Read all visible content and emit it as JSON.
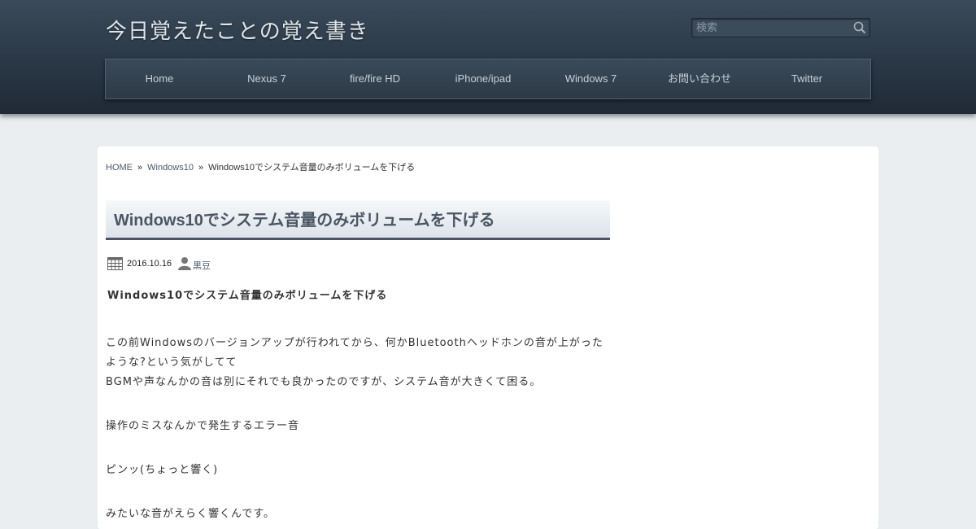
{
  "site": {
    "title": "今日覚えたことの覚え書き"
  },
  "search": {
    "placeholder": "検索",
    "icon": "search-icon"
  },
  "nav": {
    "items": [
      {
        "label": "Home"
      },
      {
        "label": "Nexus 7"
      },
      {
        "label": "fire/fire HD"
      },
      {
        "label": "iPhone/ipad"
      },
      {
        "label": "Windows 7"
      },
      {
        "label": "お問い合わせ"
      },
      {
        "label": "Twitter"
      }
    ]
  },
  "breadcrumb": {
    "home": "HOME",
    "category": "Windows10",
    "current": "Windows10でシステム音量のみボリュームを下げる",
    "separator": "»"
  },
  "post": {
    "title": "Windows10でシステム音量のみボリュームを下げる",
    "date": "2016.10.16",
    "author": "黒豆",
    "lead": "Windows10でシステム音量のみボリュームを下げる",
    "paragraph1_line1": "この前Windowsのバージョンアップが行われてから、何かBluetoothヘッドホンの音が上がった",
    "paragraph1_line2": "ような?という気がしてて",
    "paragraph1_line3": "BGMや声なんかの音は別にそれでも良かったのですが、システム音が大きくて困る。",
    "paragraph2": "操作のミスなんかで発生するエラー音",
    "paragraph3": "ピンッ(ちょっと響く)",
    "paragraph4": "みたいな音がえらく響くんです。"
  },
  "colors": {
    "header_bg": "#2a3846",
    "page_bg": "#eaeef1",
    "title_text": "#4a5663"
  }
}
